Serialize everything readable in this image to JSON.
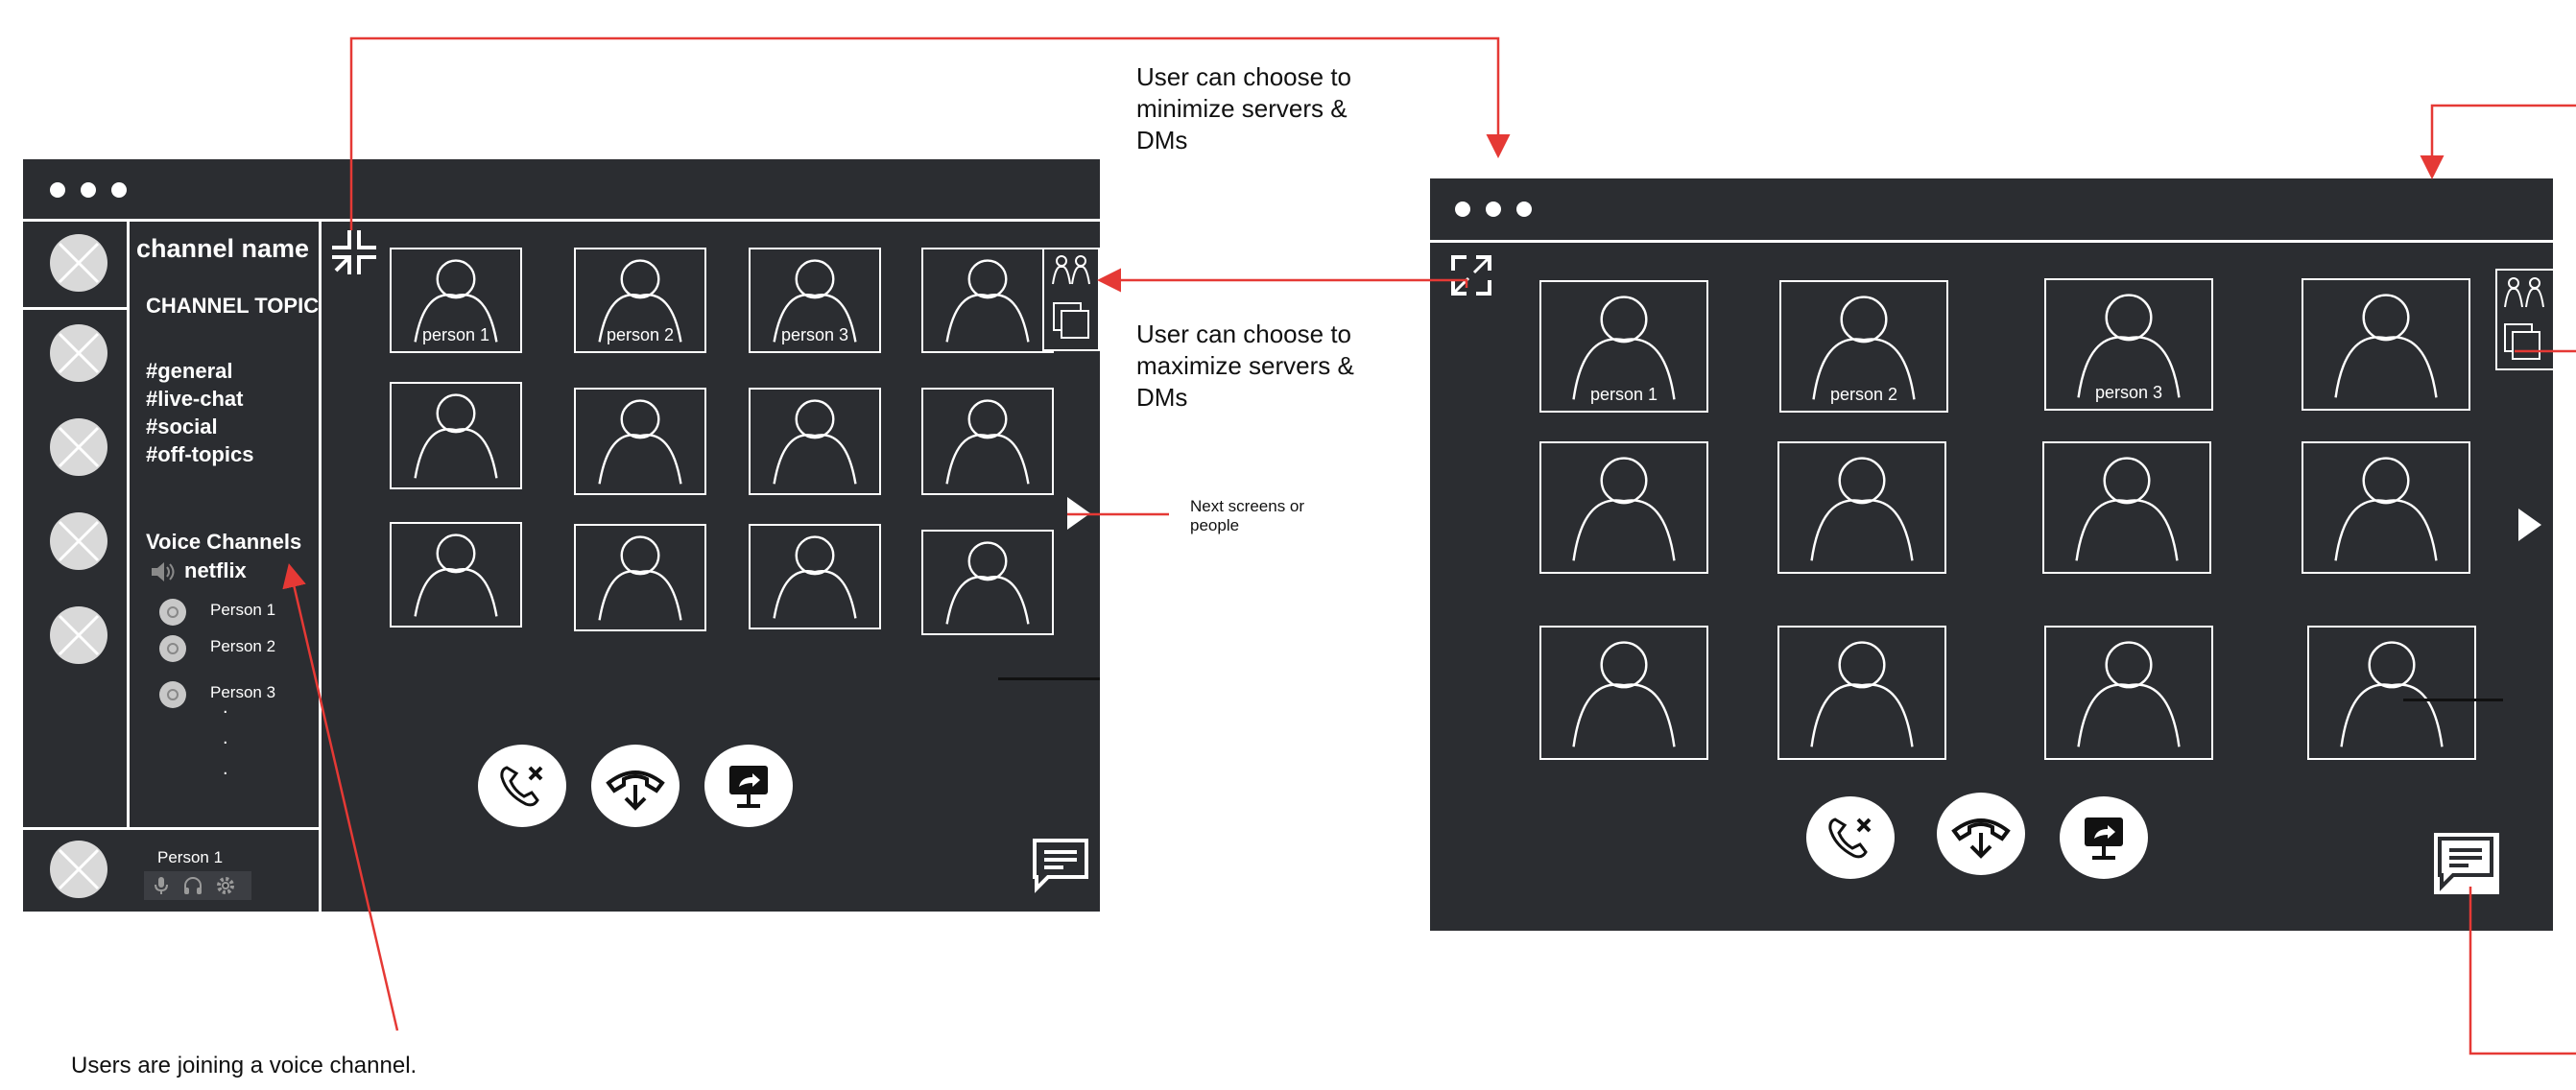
{
  "left_window": {
    "channel_name": "channel name",
    "channel_topic": "CHANNEL TOPIC",
    "text_channels": [
      "#general",
      "#live-chat",
      "#social",
      "#off-topics"
    ],
    "voice_header": "Voice Channels",
    "voice_channel": "netflix",
    "voice_members": [
      "Person 1",
      "Person 2",
      "Person 3"
    ],
    "ellipsis": [
      ".",
      ".",
      "."
    ],
    "user_name": "Person 1",
    "tile_labels": [
      "person 1",
      "person 2",
      "person 3"
    ]
  },
  "right_window": {
    "tile_labels": [
      "person 1",
      "person 2",
      "person 3"
    ]
  },
  "annotations": {
    "minimize_note": "User can choose to minimize servers & DMs",
    "maximize_note": "User can choose to maximize servers & DMs",
    "next_note": "Next screens or people",
    "join_note": "Users are joining a voice channel."
  },
  "colors": {
    "window_bg": "#2b2d31",
    "arrow": "#e53935",
    "foreground": "#ffffff"
  },
  "icons": [
    "minimize-icon",
    "maximize-icon",
    "people-icon",
    "popout-icon",
    "speaker-icon",
    "mic-icon",
    "headset-icon",
    "gear-icon",
    "end-call-icon",
    "hangup-icon",
    "share-screen-icon",
    "chat-icon",
    "next-arrow-icon"
  ]
}
